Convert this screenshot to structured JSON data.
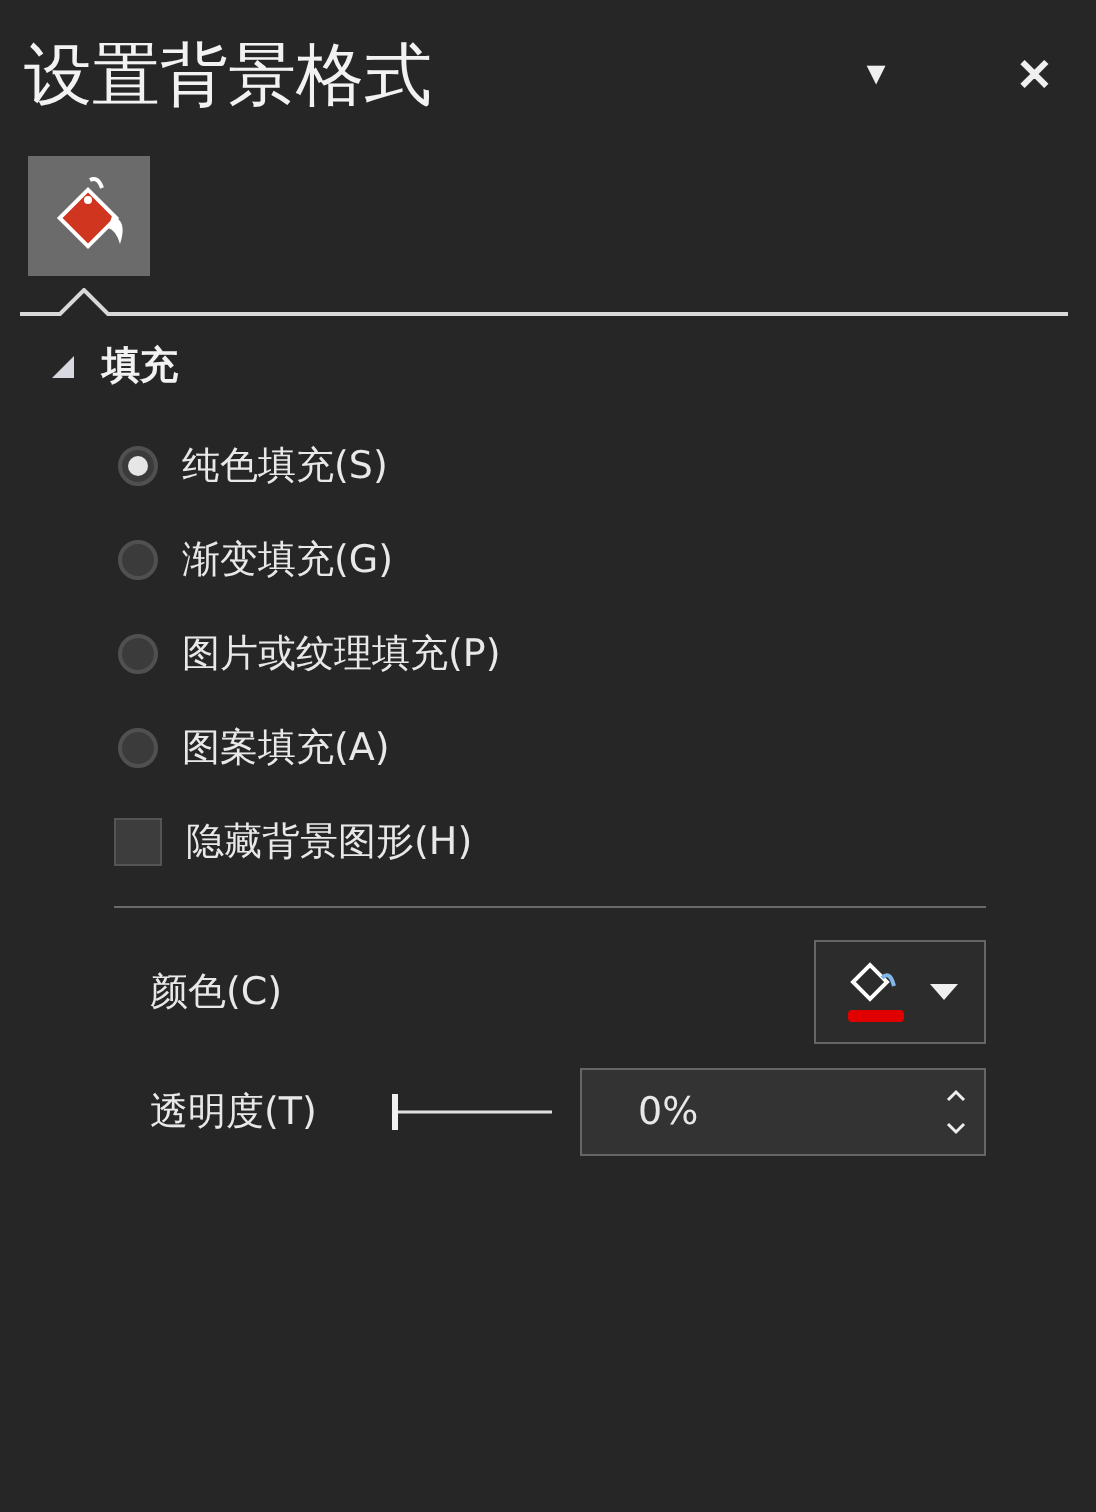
{
  "pane": {
    "title": "设置背景格式",
    "options_glyph": "▼",
    "close_glyph": "✕"
  },
  "tabs": [
    {
      "kind": "fill",
      "selected": true
    }
  ],
  "section": {
    "title": "填充",
    "expanded": true
  },
  "fill_options": [
    {
      "label": "纯色填充(S)",
      "selected": true
    },
    {
      "label": "渐变填充(G)",
      "selected": false
    },
    {
      "label": "图片或纹理填充(P)",
      "selected": false
    },
    {
      "label": "图案填充(A)",
      "selected": false
    }
  ],
  "hide_background": {
    "label": "隐藏背景图形(H)",
    "checked": false
  },
  "color": {
    "label": "颜色(C)",
    "color": "#e00000"
  },
  "transparency": {
    "label": "透明度(T)",
    "level": 0,
    "value": "0%"
  }
}
